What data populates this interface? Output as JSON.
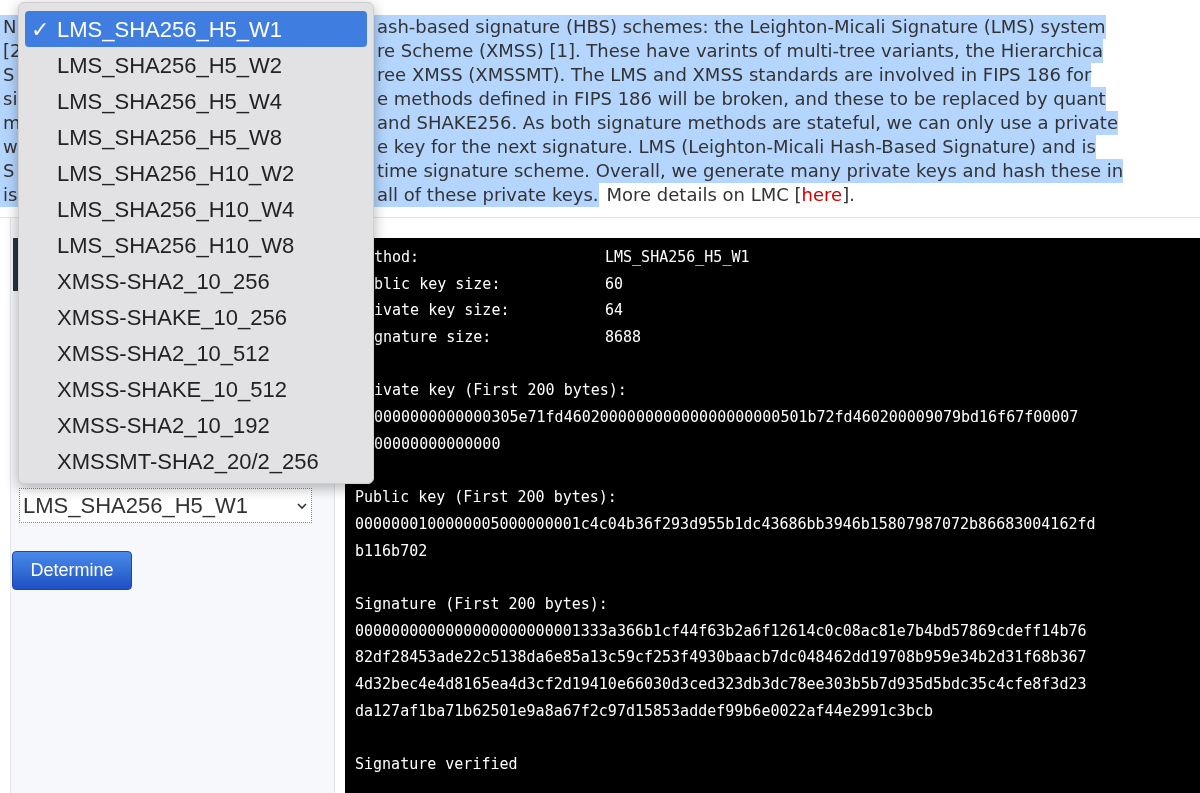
{
  "paragraph": {
    "lines": [
      {
        "left": "N",
        "right": "ash-based signature (HBS) schemes: the Leighton-Micali Signature (LMS) system",
        "selected": true
      },
      {
        "left": "[2",
        "right": "re Scheme (XMSS) [1]. These have varints of multi-tree variants, the Hierarchica",
        "selected": true
      },
      {
        "left": "S",
        "right": "ree XMSS (XMSSMT). The LMS and XMSS standards are involved in FIPS 186 for",
        "selected": true
      },
      {
        "left": "si",
        "right": "e methods defined in FIPS 186 will be broken, and these to be replaced by quant",
        "selected": true
      },
      {
        "left": "m",
        "right": "and SHAKE256. As both signature methods are stateful, we can only use a private",
        "selected": true
      },
      {
        "left": "w",
        "right": "e key for the next signature. LMS (Leighton-Micali Hash-Based Signature) and is",
        "selected": true
      },
      {
        "left": "S",
        "right": "time signature scheme. Overall, we generate many private keys and hash these in",
        "selected": true
      },
      {
        "left": "is",
        "right": "all of these private keys.",
        "selected": true
      }
    ],
    "tail": {
      "before": "More details on LMC [",
      "link": "here",
      "after": "]."
    }
  },
  "dropdown": {
    "options": [
      {
        "label": "LMS_SHA256_H5_W1",
        "selected": true
      },
      {
        "label": "LMS_SHA256_H5_W2",
        "selected": false
      },
      {
        "label": "LMS_SHA256_H5_W4",
        "selected": false
      },
      {
        "label": "LMS_SHA256_H5_W8",
        "selected": false
      },
      {
        "label": "LMS_SHA256_H10_W2",
        "selected": false
      },
      {
        "label": "LMS_SHA256_H10_W4",
        "selected": false
      },
      {
        "label": "LMS_SHA256_H10_W8",
        "selected": false
      },
      {
        "label": "XMSS-SHA2_10_256",
        "selected": false
      },
      {
        "label": "XMSS-SHAKE_10_256",
        "selected": false
      },
      {
        "label": "XMSS-SHA2_10_512",
        "selected": false
      },
      {
        "label": "XMSS-SHAKE_10_512",
        "selected": false
      },
      {
        "label": "XMSS-SHA2_10_192",
        "selected": false
      },
      {
        "label": "XMSSMT-SHA2_20/2_256",
        "selected": false
      }
    ],
    "check": "✓"
  },
  "select": {
    "value": "LMS_SHA256_H5_W1"
  },
  "button": {
    "label": "Determine"
  },
  "console": {
    "lines": [
      {
        "kind": "pair",
        "key": "thod:",
        "value": "LMS_SHA256_H5_W1"
      },
      {
        "kind": "pair",
        "key": "blic key size:",
        "value": "60"
      },
      {
        "kind": "pair",
        "key": "ivate key size:",
        "value": "64"
      },
      {
        "kind": "pair",
        "key": "gnature size:",
        "value": "8688"
      },
      {
        "kind": "blank"
      },
      {
        "kind": "clipped",
        "text": "ivate key (First 200 bytes):"
      },
      {
        "kind": "clipped",
        "text": "0000000000000305e71fd460200000000000000000000501b72fd460200009079bd16f67f00007"
      },
      {
        "kind": "clipped",
        "text": "00000000000000"
      },
      {
        "kind": "blank"
      },
      {
        "kind": "text",
        "text": "Public key (First 200 bytes):"
      },
      {
        "kind": "text",
        "text": "0000000100000005000000001c4c04b36f293d955b1dc43686bb3946b15807987072b86683004162fd"
      },
      {
        "kind": "text",
        "text": "b116b702"
      },
      {
        "kind": "blank"
      },
      {
        "kind": "text",
        "text": "Signature (First 200 bytes):"
      },
      {
        "kind": "text",
        "text": "0000000000000000000000001333a366b1cf44f63b2a6f12614c0c08ac81e7b4bd57869cdeff14b76"
      },
      {
        "kind": "text",
        "text": "82df28453ade22c5138da6e85a13c59cf253f4930baacb7dc048462dd19708b959e34b2d31f68b367"
      },
      {
        "kind": "text",
        "text": "4d32bec4e4d8165ea4d3cf2d19410e66030d3ced323db3dc78ee303b5b7d935d5bdc35c4cfe8f3d23"
      },
      {
        "kind": "text",
        "text": "da127af1ba71b62501e9a8a67f2c97d15853addef99b6e0022af44e2991c3bcb"
      },
      {
        "kind": "blank"
      },
      {
        "kind": "text",
        "text": "Signature verified"
      }
    ]
  }
}
